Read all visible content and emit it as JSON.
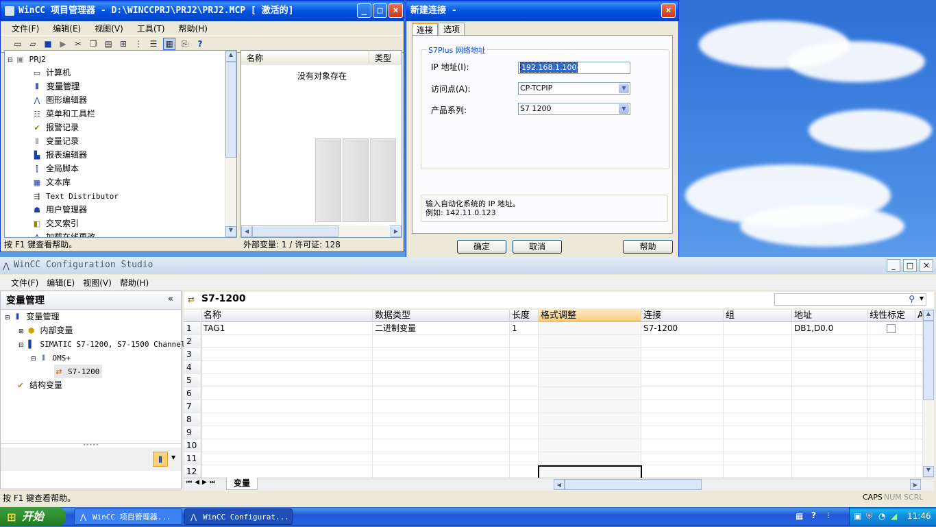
{
  "desktop": {
    "background": "blue-sky-clouds"
  },
  "project_manager": {
    "title": "WinCC 项目管理器 - D:\\WINCCPRJ\\PRJ2\\PRJ2.MCP [ 激活的]",
    "menu": [
      "文件(F)",
      "编辑(E)",
      "视图(V)",
      "工具(T)",
      "帮助(H)"
    ],
    "tree": [
      {
        "label": "PRJ2",
        "icon": "project-icon"
      },
      {
        "label": "计算机",
        "icon": "computer-icon"
      },
      {
        "label": "变量管理",
        "icon": "tag-management-icon"
      },
      {
        "label": "图形编辑器",
        "icon": "graphics-designer-icon"
      },
      {
        "label": "菜单和工具栏",
        "icon": "menu-toolbar-icon"
      },
      {
        "label": "报警记录",
        "icon": "alarm-logging-icon"
      },
      {
        "label": "变量记录",
        "icon": "tag-logging-icon"
      },
      {
        "label": "报表编辑器",
        "icon": "report-designer-icon"
      },
      {
        "label": "全局脚本",
        "icon": "global-script-icon"
      },
      {
        "label": "文本库",
        "icon": "text-library-icon"
      },
      {
        "label": "Text Distributor",
        "icon": "text-distributor-icon"
      },
      {
        "label": "用户管理器",
        "icon": "user-admin-icon"
      },
      {
        "label": "交叉索引",
        "icon": "cross-reference-icon"
      },
      {
        "label": "加载在线更改",
        "icon": "load-online-changes-icon"
      }
    ],
    "list_headers": {
      "name": "名称",
      "type": "类型"
    },
    "empty_text": "没有对象存在",
    "status_left": "按 F1 键查看帮助。",
    "status_right": "外部变量: 1 / 许可证: 128"
  },
  "dialog": {
    "title": "新建连接 -",
    "tabs": [
      "连接",
      "选项"
    ],
    "group_title": "S7Plus 网络地址",
    "ip_label": "IP 地址(I):",
    "ip_value": "192.168.1.100",
    "access_label": "访问点(A):",
    "access_value": "CP-TCPIP",
    "series_label": "产品系列:",
    "series_value": "S7 1200",
    "hint_line1": "输入自动化系统的 IP 地址。",
    "hint_line2": "例如: 142.11.0.123",
    "ok": "确定",
    "cancel": "取消",
    "help": "帮助"
  },
  "config_studio": {
    "title": "WinCC Configuration Studio",
    "menu": [
      "文件(F)",
      "编辑(E)",
      "视图(V)",
      "帮助(H)"
    ],
    "nav_title": "变量管理",
    "nav_collapse": "«",
    "nav_tree": [
      {
        "label": "变量管理",
        "icon": "tag-management-icon"
      },
      {
        "label": "内部变量",
        "icon": "internal-tags-icon"
      },
      {
        "label": "SIMATIC S7-1200, S7-1500 Channel",
        "icon": "channel-icon"
      },
      {
        "label": "OMS+",
        "icon": "driver-icon"
      },
      {
        "label": "S7-1200",
        "icon": "connection-icon"
      },
      {
        "label": "结构变量",
        "icon": "structure-tags-icon"
      }
    ],
    "grid_title": "S7-1200",
    "search_placeholder": "",
    "columns": [
      "名称",
      "数据类型",
      "长度",
      "格式调整",
      "连接",
      "组",
      "地址",
      "线性标定",
      "A"
    ],
    "rows": [
      {
        "n": "1",
        "cells": [
          "TAG1",
          "二进制变量",
          "1",
          "",
          "S7-1200",
          "",
          "DB1,D0.0",
          ""
        ]
      },
      {
        "n": "2",
        "cells": [
          "",
          "",
          "",
          "",
          "",
          "",
          "",
          ""
        ]
      },
      {
        "n": "3",
        "cells": [
          "",
          "",
          "",
          "",
          "",
          "",
          "",
          ""
        ]
      },
      {
        "n": "4",
        "cells": [
          "",
          "",
          "",
          "",
          "",
          "",
          "",
          ""
        ]
      },
      {
        "n": "5",
        "cells": [
          "",
          "",
          "",
          "",
          "",
          "",
          "",
          ""
        ]
      },
      {
        "n": "6",
        "cells": [
          "",
          "",
          "",
          "",
          "",
          "",
          "",
          ""
        ]
      },
      {
        "n": "7",
        "cells": [
          "",
          "",
          "",
          "",
          "",
          "",
          "",
          ""
        ]
      },
      {
        "n": "8",
        "cells": [
          "",
          "",
          "",
          "",
          "",
          "",
          "",
          ""
        ]
      },
      {
        "n": "9",
        "cells": [
          "",
          "",
          "",
          "",
          "",
          "",
          "",
          ""
        ]
      },
      {
        "n": "10",
        "cells": [
          "",
          "",
          "",
          "",
          "",
          "",
          "",
          ""
        ]
      },
      {
        "n": "11",
        "cells": [
          "",
          "",
          "",
          "",
          "",
          "",
          "",
          ""
        ]
      },
      {
        "n": "12",
        "cells": [
          "",
          "",
          "",
          "",
          "",
          "",
          "",
          ""
        ]
      }
    ],
    "sheet_tab": "变量",
    "status_left": "按 F1 键查看帮助。",
    "caps": "CAPS",
    "num": "NUM",
    "scrl": "SCRL"
  },
  "taskbar": {
    "start": "开始",
    "items": [
      "WinCC 项目管理器...",
      "WinCC Configurat..."
    ],
    "clock": "11:46"
  },
  "colors": {
    "xp_blue": "#0053e1",
    "header_highlight": "#f9c976",
    "selection": "#316ac5"
  }
}
